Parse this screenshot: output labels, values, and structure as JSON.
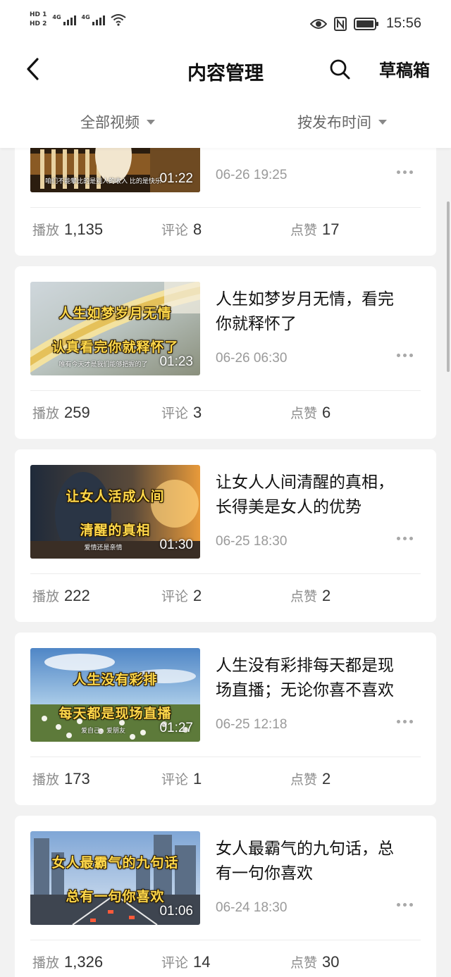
{
  "status_bar": {
    "time": "15:56",
    "sim1": "HD 1",
    "sim2": "HD 2",
    "network1": "4G",
    "network2": "4G"
  },
  "header": {
    "title": "内容管理",
    "drafts_label": "草稿箱"
  },
  "filters": {
    "category": "全部视频",
    "sort": "按发布时间"
  },
  "stat_labels": {
    "plays": "播放",
    "comments": "评论",
    "likes": "点赞"
  },
  "videos": [
    {
      "title": "",
      "caption_line1": "",
      "caption_line2": "",
      "subtitle": "咱们不能攀比的是别人的收入 比的是快乐",
      "duration": "01:22",
      "date": "06-26 19:25",
      "plays": "1,135",
      "comments": "8",
      "likes": "17"
    },
    {
      "title": "人生如梦岁月无情，看完你就释怀了",
      "caption_line1": "人生如梦岁月无情",
      "caption_line2": "认真看完你就释怀了",
      "subtitle": "唯有今天才是我们能够把握的了",
      "duration": "01:23",
      "date": "06-26 06:30",
      "plays": "259",
      "comments": "3",
      "likes": "6"
    },
    {
      "title": "让女人人间清醒的真相，长得美是女人的优势",
      "caption_line1": "让女人活成人间",
      "caption_line2": "清醒的真相",
      "subtitle": "爱情还是亲情",
      "duration": "01:30",
      "date": "06-25 18:30",
      "plays": "222",
      "comments": "2",
      "likes": "2"
    },
    {
      "title": "人生没有彩排每天都是现场直播；无论你喜不喜欢",
      "caption_line1": "人生没有彩排",
      "caption_line2": "每天都是现场直播",
      "subtitle": "爱自己，爱朋友",
      "duration": "01:27",
      "date": "06-25 12:18",
      "plays": "173",
      "comments": "1",
      "likes": "2"
    },
    {
      "title": "女人最霸气的九句话，总有一句你喜欢",
      "caption_line1": "女人最霸气的九句话",
      "caption_line2": "总有一句你喜欢",
      "subtitle": "",
      "duration": "01:06",
      "date": "06-24 18:30",
      "plays": "1,326",
      "comments": "14",
      "likes": "30"
    }
  ]
}
